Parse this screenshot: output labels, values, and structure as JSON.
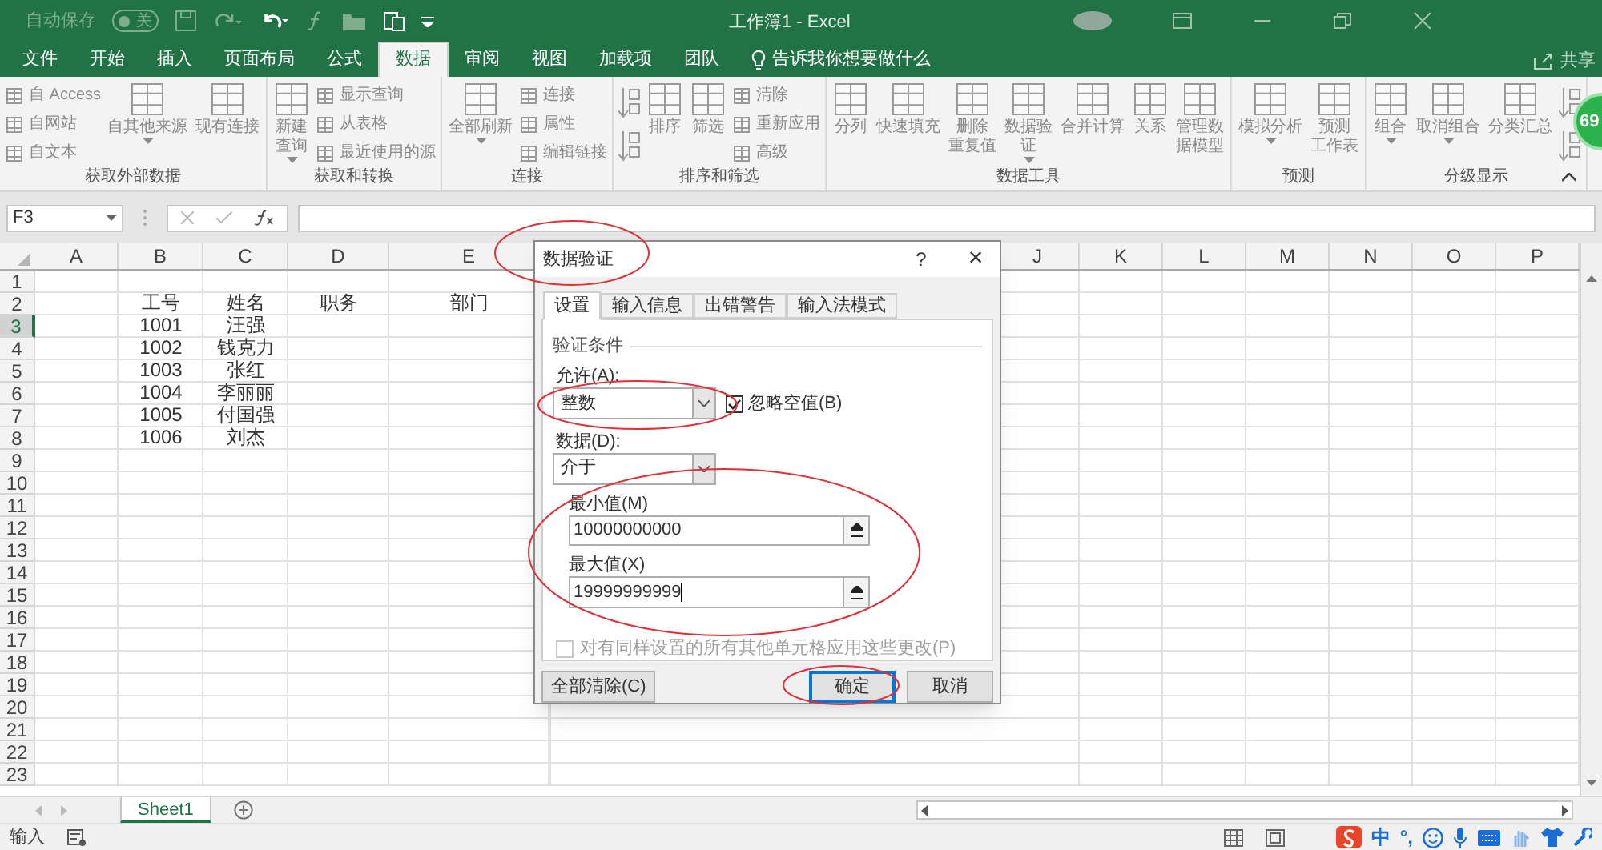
{
  "title_bar": {
    "autosave_label": "自动保存",
    "autosave_on": false,
    "autosave_state": "关",
    "title": "工作簿1 - Excel"
  },
  "menu_tabs": [
    {
      "label": "文件",
      "selected": false
    },
    {
      "label": "开始",
      "selected": false
    },
    {
      "label": "插入",
      "selected": false
    },
    {
      "label": "页面布局",
      "selected": false
    },
    {
      "label": "公式",
      "selected": false
    },
    {
      "label": "数据",
      "selected": true
    },
    {
      "label": "审阅",
      "selected": false
    },
    {
      "label": "视图",
      "selected": false
    },
    {
      "label": "加载项",
      "selected": false
    },
    {
      "label": "团队",
      "selected": false
    }
  ],
  "tell_me": "告诉我你想要做什么",
  "share": "共享",
  "ribbon_groups": [
    {
      "label": "获取外部数据",
      "items": [
        {
          "kind": "small",
          "label": "自 Access"
        },
        {
          "kind": "small",
          "label": "自网站"
        },
        {
          "kind": "small",
          "label": "自文本"
        },
        {
          "kind": "large",
          "lines": [
            "自其他来源"
          ],
          "dropdown": true
        },
        {
          "kind": "large",
          "lines": [
            "现有连接"
          ],
          "dropdown": false
        }
      ]
    },
    {
      "label": "获取和转换",
      "items": [
        {
          "kind": "large",
          "lines": [
            "新建",
            "查询"
          ],
          "dropdown": true
        },
        {
          "kind": "small",
          "label": "显示查询"
        },
        {
          "kind": "small",
          "label": "从表格"
        },
        {
          "kind": "small",
          "label": "最近使用的源"
        }
      ]
    },
    {
      "label": "连接",
      "items": [
        {
          "kind": "large",
          "lines": [
            "全部刷新"
          ],
          "dropdown": true
        },
        {
          "kind": "small",
          "label": "连接"
        },
        {
          "kind": "small",
          "label": "属性"
        },
        {
          "kind": "small",
          "label": "编辑链接"
        }
      ]
    },
    {
      "label": "排序和筛选",
      "items": [
        {
          "kind": "icon"
        },
        {
          "kind": "icon"
        },
        {
          "kind": "large",
          "lines": [
            "排序"
          ],
          "dropdown": false
        },
        {
          "kind": "large",
          "lines": [
            "筛选"
          ],
          "dropdown": false
        },
        {
          "kind": "small",
          "label": "清除"
        },
        {
          "kind": "small",
          "label": "重新应用"
        },
        {
          "kind": "small",
          "label": "高级"
        }
      ]
    },
    {
      "label": "数据工具",
      "items": [
        {
          "kind": "large",
          "lines": [
            "分列"
          ],
          "dropdown": false
        },
        {
          "kind": "large",
          "lines": [
            "快速填充"
          ],
          "dropdown": false
        },
        {
          "kind": "large",
          "lines": [
            "删除",
            "重复值"
          ],
          "dropdown": false
        },
        {
          "kind": "large",
          "lines": [
            "数据验",
            "证"
          ],
          "dropdown": true
        },
        {
          "kind": "large",
          "lines": [
            "合并计算"
          ],
          "dropdown": false
        },
        {
          "kind": "large",
          "lines": [
            "关系"
          ],
          "dropdown": false
        },
        {
          "kind": "large",
          "lines": [
            "管理数",
            "据模型"
          ],
          "dropdown": false
        }
      ]
    },
    {
      "label": "预测",
      "items": [
        {
          "kind": "large",
          "lines": [
            "模拟分析"
          ],
          "dropdown": true
        },
        {
          "kind": "large",
          "lines": [
            "预测",
            "工作表"
          ],
          "dropdown": false
        }
      ]
    },
    {
      "label": "分级显示",
      "items": [
        {
          "kind": "large",
          "lines": [
            "组合"
          ],
          "dropdown": true
        },
        {
          "kind": "large",
          "lines": [
            "取消组合"
          ],
          "dropdown": true
        },
        {
          "kind": "large",
          "lines": [
            "分类汇总"
          ],
          "dropdown": false
        },
        {
          "kind": "icon"
        },
        {
          "kind": "icon"
        }
      ]
    }
  ],
  "badge": "69",
  "name_box": "F3",
  "columns": [
    "A",
    "B",
    "C",
    "D",
    "E",
    "J",
    "K",
    "L",
    "M",
    "N",
    "O",
    "P"
  ],
  "rows": [
    {
      "number": "1",
      "selected": false
    },
    {
      "number": "2",
      "selected": false,
      "cells": [
        null,
        "工号",
        "姓名",
        "职务",
        "部门"
      ]
    },
    {
      "number": "3",
      "selected": true,
      "cells": [
        null,
        "1001",
        "汪强"
      ]
    },
    {
      "number": "4",
      "selected": false,
      "cells": [
        null,
        "1002",
        "钱克力"
      ]
    },
    {
      "number": "5",
      "selected": false,
      "cells": [
        null,
        "1003",
        "张红"
      ]
    },
    {
      "number": "6",
      "selected": false,
      "cells": [
        null,
        "1004",
        "李丽丽"
      ]
    },
    {
      "number": "7",
      "selected": false,
      "cells": [
        null,
        "1005",
        "付国强"
      ]
    },
    {
      "number": "8",
      "selected": false,
      "cells": [
        null,
        "1006",
        "刘杰"
      ]
    },
    {
      "number": "9",
      "selected": false
    },
    {
      "number": "10",
      "selected": false
    },
    {
      "number": "11",
      "selected": false
    },
    {
      "number": "12",
      "selected": false
    },
    {
      "number": "13",
      "selected": false
    },
    {
      "number": "14",
      "selected": false
    },
    {
      "number": "15",
      "selected": false
    },
    {
      "number": "16",
      "selected": false
    },
    {
      "number": "17",
      "selected": false
    },
    {
      "number": "18",
      "selected": false
    },
    {
      "number": "19",
      "selected": false
    },
    {
      "number": "20",
      "selected": false
    },
    {
      "number": "21",
      "selected": false
    },
    {
      "number": "22",
      "selected": false
    },
    {
      "number": "23",
      "selected": false
    }
  ],
  "sheet_tabs": [
    {
      "label": "Sheet1",
      "selected": true
    }
  ],
  "status_bar": {
    "mode": "输入",
    "ime": [
      "中",
      "°,"
    ]
  },
  "dialog": {
    "title": "数据验证",
    "help": "?",
    "close": "×",
    "tabs": [
      {
        "label": "设置",
        "selected": true
      },
      {
        "label": "输入信息",
        "selected": false
      },
      {
        "label": "出错警告",
        "selected": false
      },
      {
        "label": "输入法模式",
        "selected": false
      }
    ],
    "section": "验证条件",
    "allow_label": "允许(A):",
    "allow_value": "整数",
    "ignore_blank": {
      "label": "忽略空值(B)",
      "checked": true
    },
    "data_label": "数据(D):",
    "data_value": "介于",
    "min_label": "最小值(M)",
    "min_value": "10000000000",
    "min_focused": false,
    "max_label": "最大值(X)",
    "max_value": "19999999999",
    "max_focused": true,
    "apply_all": {
      "label": "对有同样设置的所有其他单元格应用这些更改(P)",
      "checked": false,
      "disabled": true
    },
    "buttons": [
      {
        "label": "全部清除(C)",
        "default": false
      },
      {
        "label": "确定",
        "default": true
      },
      {
        "label": "取消",
        "default": false
      }
    ]
  },
  "annotations": [
    {
      "kind": "ellipse"
    },
    {
      "kind": "ellipse"
    },
    {
      "kind": "ellipse"
    },
    {
      "kind": "ellipse"
    }
  ]
}
